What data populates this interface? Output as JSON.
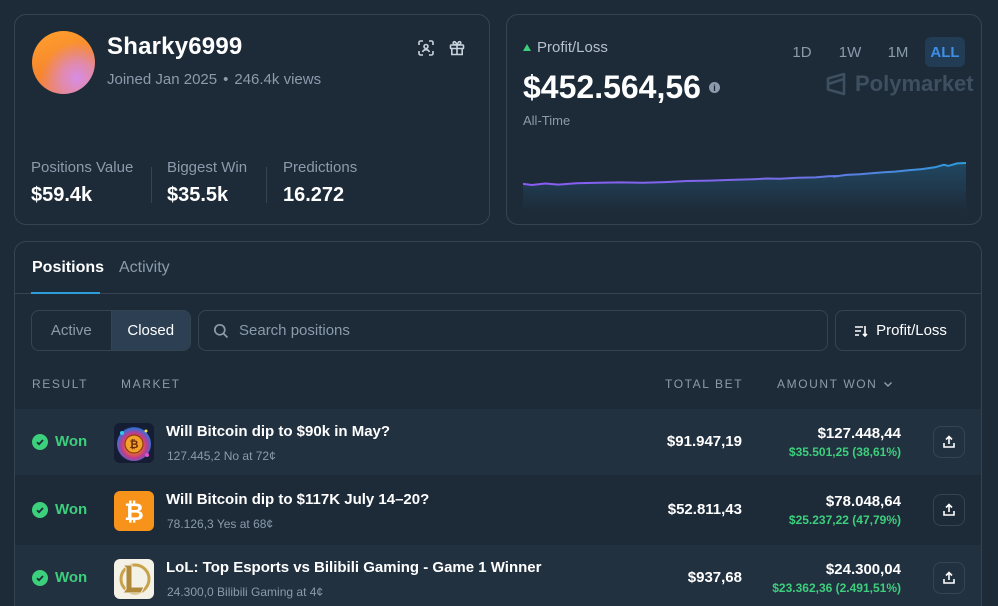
{
  "profile": {
    "username": "Sharky6999",
    "joined": "Joined Jan 2025",
    "separator": "•",
    "views": "246.4k views",
    "stats": [
      {
        "label": "Positions Value",
        "value": "$59.4k"
      },
      {
        "label": "Biggest Win",
        "value": "$35.5k"
      },
      {
        "label": "Predictions",
        "value": "16.272"
      }
    ]
  },
  "pnl": {
    "label": "Profit/Loss",
    "value": "$452.564,56",
    "info_glyph": "i",
    "period": "All-Time",
    "timeframes": [
      "1D",
      "1W",
      "1M",
      "ALL"
    ],
    "active_timeframe": "ALL",
    "brand": "Polymarket",
    "colors": {
      "up": "#3ccf7c",
      "line_start": "#8a5cf5",
      "line_end": "#2d9cdb"
    }
  },
  "positions": {
    "tabs": [
      "Positions",
      "Activity"
    ],
    "active_tab": "Positions",
    "filter": {
      "active": "Active",
      "closed": "Closed",
      "selected": "Closed"
    },
    "search_placeholder": "Search positions",
    "sort_label": "Profit/Loss",
    "columns": {
      "result": "RESULT",
      "market": "MARKET",
      "total_bet": "TOTAL BET",
      "amount_won": "AMOUNT WON"
    },
    "rows": [
      {
        "result": "Won",
        "title": "Will Bitcoin dip to $90k in May?",
        "subtitle": "127.445,2 No at 72¢",
        "total_bet": "$91.947,19",
        "amount_won": "$127.448,44",
        "gain": "$35.501,25 (38,61%)",
        "icon": "bitcoin-art-icon"
      },
      {
        "result": "Won",
        "title": "Will Bitcoin dip to $117K July 14–20?",
        "subtitle": "78.126,3 Yes at 68¢",
        "total_bet": "$52.811,43",
        "amount_won": "$78.048,64",
        "gain": "$25.237,22 (47,79%)",
        "icon": "bitcoin-logo-icon"
      },
      {
        "result": "Won",
        "title": "LoL: Top Esports vs Bilibili Gaming - Game 1 Winner",
        "subtitle": "24.300,0 Bilibili Gaming at 4¢",
        "total_bet": "$937,68",
        "amount_won": "$24.300,04",
        "gain": "$23.362,36 (2.491,51%)",
        "icon": "league-of-legends-icon"
      }
    ]
  }
}
